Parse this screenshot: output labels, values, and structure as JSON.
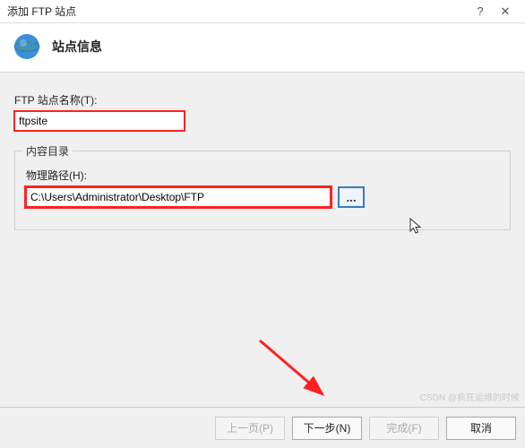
{
  "window": {
    "title": "添加 FTP 站点",
    "help": "?",
    "close": "✕"
  },
  "header": {
    "heading": "站点信息"
  },
  "site_name": {
    "label": "FTP 站点名称(T):",
    "value": "ftpsite"
  },
  "content_dir": {
    "legend": "内容目录",
    "path_label": "物理路径(H):",
    "path_value": "C:\\Users\\Administrator\\Desktop\\FTP",
    "browse_label": "..."
  },
  "footer": {
    "prev": "上一页(P)",
    "next": "下一步(N)",
    "finish": "完成(F)",
    "cancel": "取消"
  },
  "watermark": "CSDN @疯狂运维的时候"
}
